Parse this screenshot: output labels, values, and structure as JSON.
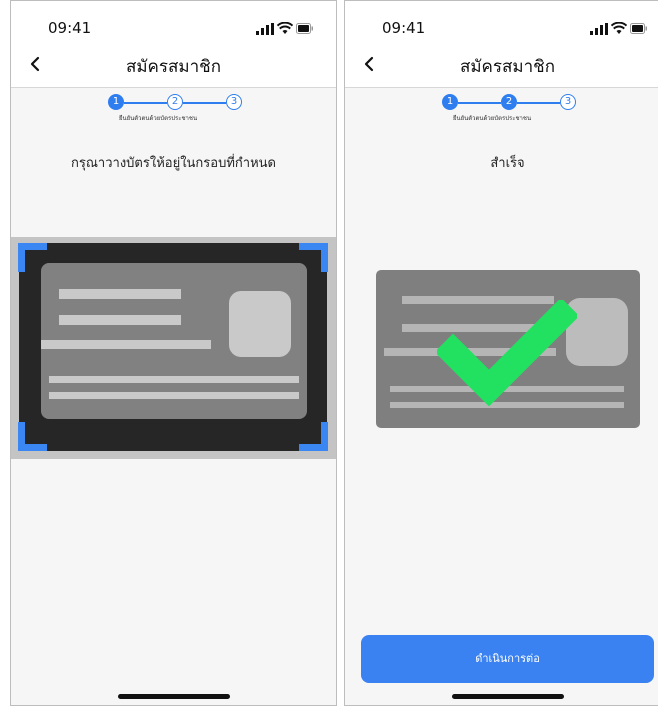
{
  "status_bar": {
    "time": "09:41"
  },
  "header": {
    "title": "สมัครสมาชิก"
  },
  "stepper": {
    "steps": [
      "1",
      "2",
      "3"
    ],
    "label": "ยืนยันตัวตนด้วยบัตรประชาชน"
  },
  "left_screen": {
    "instruction": "กรุณาวางบัตรให้อยู่ในกรอบที่กำหนด",
    "current_step": 1
  },
  "right_screen": {
    "status_text": "สำเร็จ",
    "current_step": 2,
    "continue_label": "ดำเนินการต่อ"
  },
  "colors": {
    "accent": "#2f7ef0",
    "button": "#3a82f1",
    "checkmark": "#22e060",
    "card": "#7f7f7f",
    "scan_corner": "#3a86f2"
  },
  "icons": [
    "chevron-left-icon",
    "signal-icon",
    "wifi-icon",
    "battery-icon",
    "checkmark-icon"
  ]
}
